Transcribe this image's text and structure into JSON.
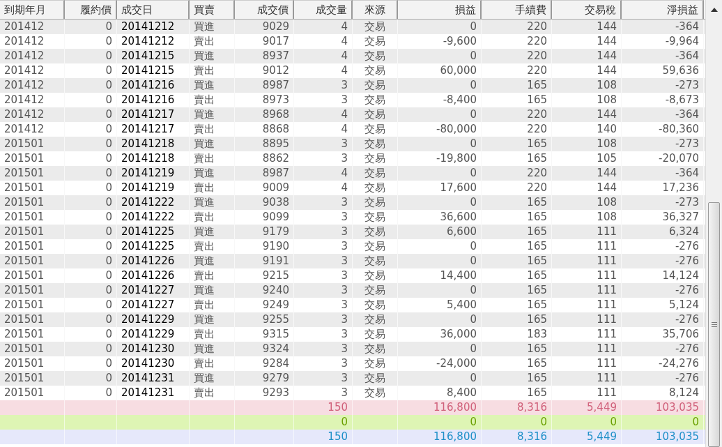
{
  "table": {
    "columns": [
      "到期年月",
      "履約價",
      "成交日",
      "買賣",
      "成交價",
      "成交量",
      "來源",
      "損益",
      "手續費",
      "交易稅",
      "淨損益"
    ],
    "rows": [
      [
        "201412",
        "0",
        "20141212",
        "買進",
        "9029",
        "4",
        "交易",
        "0",
        "220",
        "144",
        "-364"
      ],
      [
        "201412",
        "0",
        "20141212",
        "賣出",
        "9017",
        "4",
        "交易",
        "-9,600",
        "220",
        "144",
        "-9,964"
      ],
      [
        "201412",
        "0",
        "20141215",
        "買進",
        "8937",
        "4",
        "交易",
        "0",
        "220",
        "144",
        "-364"
      ],
      [
        "201412",
        "0",
        "20141215",
        "賣出",
        "9012",
        "4",
        "交易",
        "60,000",
        "220",
        "144",
        "59,636"
      ],
      [
        "201412",
        "0",
        "20141216",
        "買進",
        "8987",
        "3",
        "交易",
        "0",
        "165",
        "108",
        "-273"
      ],
      [
        "201412",
        "0",
        "20141216",
        "賣出",
        "8973",
        "3",
        "交易",
        "-8,400",
        "165",
        "108",
        "-8,673"
      ],
      [
        "201412",
        "0",
        "20141217",
        "買進",
        "8968",
        "4",
        "交易",
        "0",
        "220",
        "144",
        "-364"
      ],
      [
        "201412",
        "0",
        "20141217",
        "賣出",
        "8868",
        "4",
        "交易",
        "-80,000",
        "220",
        "140",
        "-80,360"
      ],
      [
        "201501",
        "0",
        "20141218",
        "買進",
        "8895",
        "3",
        "交易",
        "0",
        "165",
        "108",
        "-273"
      ],
      [
        "201501",
        "0",
        "20141218",
        "賣出",
        "8862",
        "3",
        "交易",
        "-19,800",
        "165",
        "105",
        "-20,070"
      ],
      [
        "201501",
        "0",
        "20141219",
        "買進",
        "8987",
        "4",
        "交易",
        "0",
        "220",
        "144",
        "-364"
      ],
      [
        "201501",
        "0",
        "20141219",
        "賣出",
        "9009",
        "4",
        "交易",
        "17,600",
        "220",
        "144",
        "17,236"
      ],
      [
        "201501",
        "0",
        "20141222",
        "買進",
        "9038",
        "3",
        "交易",
        "0",
        "165",
        "108",
        "-273"
      ],
      [
        "201501",
        "0",
        "20141222",
        "賣出",
        "9099",
        "3",
        "交易",
        "36,600",
        "165",
        "108",
        "36,327"
      ],
      [
        "201501",
        "0",
        "20141225",
        "買進",
        "9179",
        "3",
        "交易",
        "6,600",
        "165",
        "111",
        "6,324"
      ],
      [
        "201501",
        "0",
        "20141225",
        "賣出",
        "9190",
        "3",
        "交易",
        "0",
        "165",
        "111",
        "-276"
      ],
      [
        "201501",
        "0",
        "20141226",
        "買進",
        "9191",
        "3",
        "交易",
        "0",
        "165",
        "111",
        "-276"
      ],
      [
        "201501",
        "0",
        "20141226",
        "賣出",
        "9215",
        "3",
        "交易",
        "14,400",
        "165",
        "111",
        "14,124"
      ],
      [
        "201501",
        "0",
        "20141227",
        "買進",
        "9240",
        "3",
        "交易",
        "0",
        "165",
        "111",
        "-276"
      ],
      [
        "201501",
        "0",
        "20141227",
        "賣出",
        "9249",
        "3",
        "交易",
        "5,400",
        "165",
        "111",
        "5,124"
      ],
      [
        "201501",
        "0",
        "20141229",
        "買進",
        "9255",
        "3",
        "交易",
        "0",
        "165",
        "111",
        "-276"
      ],
      [
        "201501",
        "0",
        "20141229",
        "賣出",
        "9315",
        "3",
        "交易",
        "36,000",
        "183",
        "111",
        "35,706"
      ],
      [
        "201501",
        "0",
        "20141230",
        "買進",
        "9324",
        "3",
        "交易",
        "0",
        "165",
        "111",
        "-276"
      ],
      [
        "201501",
        "0",
        "20141230",
        "賣出",
        "9284",
        "3",
        "交易",
        "-24,000",
        "165",
        "111",
        "-24,276"
      ],
      [
        "201501",
        "0",
        "20141231",
        "買進",
        "9279",
        "3",
        "交易",
        "0",
        "165",
        "111",
        "-276"
      ],
      [
        "201501",
        "0",
        "20141231",
        "賣出",
        "9293",
        "3",
        "交易",
        "8,400",
        "165",
        "111",
        "8,124"
      ]
    ],
    "totals": [
      {
        "color": "#d0607a",
        "qty": "150",
        "pnl": "116,800",
        "fee": "8,316",
        "tax": "5,449",
        "net": "103,035"
      },
      {
        "color": "#6aa000",
        "qty": "0",
        "pnl": "0",
        "fee": "0",
        "tax": "0",
        "net": "0"
      },
      {
        "color": "#1e8fc8",
        "qty": "150",
        "pnl": "116,800",
        "fee": "8,316",
        "tax": "5,449",
        "net": "103,035"
      }
    ]
  }
}
